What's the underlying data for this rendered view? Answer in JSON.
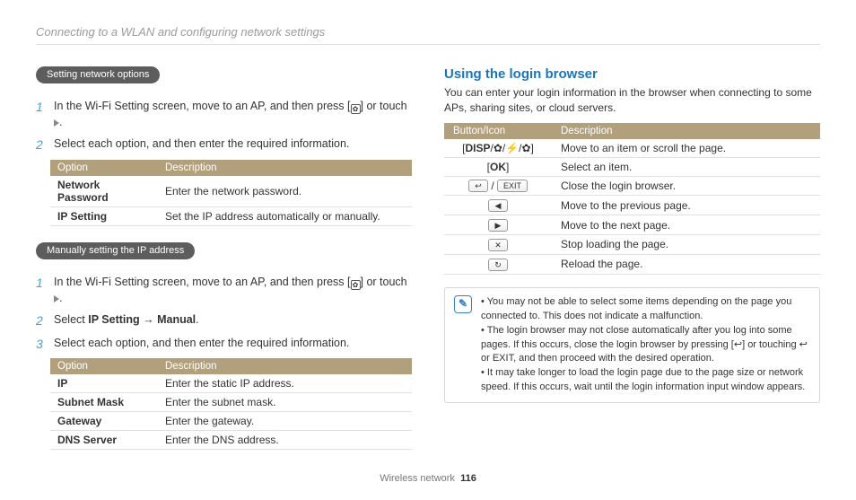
{
  "header": "Connecting to a WLAN and configuring network settings",
  "left": {
    "section1": {
      "pill": "Setting network options",
      "step1_pre": "In the Wi-Fi Setting screen, move to an AP, and then press ",
      "step1_post": " or touch ",
      "step1_end": ".",
      "step2": "Select each option, and then enter the required information.",
      "table": {
        "h1": "Option",
        "h2": "Description",
        "rows": [
          {
            "k": "Network Password",
            "v": "Enter the network password."
          },
          {
            "k": "IP Setting",
            "v": "Set the IP address automatically or manually."
          }
        ]
      }
    },
    "section2": {
      "pill": "Manually setting the IP address",
      "step1_pre": "In the Wi-Fi Setting screen, move to an AP, and then press ",
      "step1_post": " or touch ",
      "step1_end": ".",
      "step2_pre": "Select ",
      "step2_b1": "IP Setting",
      "step2_arrow": " → ",
      "step2_b2": "Manual",
      "step2_end": ".",
      "step3": "Select each option, and then enter the required information.",
      "table": {
        "h1": "Option",
        "h2": "Description",
        "rows": [
          {
            "k": "IP",
            "v": "Enter the static IP address."
          },
          {
            "k": "Subnet Mask",
            "v": "Enter the subnet mask."
          },
          {
            "k": "Gateway",
            "v": "Enter the gateway."
          },
          {
            "k": "DNS Server",
            "v": "Enter the DNS address."
          }
        ]
      }
    }
  },
  "right": {
    "title": "Using the login browser",
    "intro": "You can enter your login information in the browser when connecting to some APs, sharing sites, or cloud servers.",
    "table": {
      "h1": "Button/Icon",
      "h2": "Description",
      "rows": [
        {
          "icon": "disp-nav",
          "v": "Move to an item or scroll the page."
        },
        {
          "icon": "ok",
          "v": "Select an item."
        },
        {
          "icon": "back-exit",
          "v": "Close the login browser."
        },
        {
          "icon": "prev",
          "v": "Move to the previous page."
        },
        {
          "icon": "next",
          "v": "Move to the next page."
        },
        {
          "icon": "stop",
          "v": "Stop loading the page."
        },
        {
          "icon": "reload",
          "v": "Reload the page."
        }
      ]
    },
    "notes": [
      "You may not be able to select some items depending on the page you connected to. This does not indicate a malfunction.",
      "The login browser may not close automatically after you log into some pages. If this occurs, close the login browser by pressing [↩] or touching ↩ or EXIT, and then proceed with the desired operation.",
      "It may take longer to load the login page due to the page size or network speed. If this occurs, wait until the login information input window appears."
    ]
  },
  "footer": {
    "section": "Wireless network",
    "page": "116"
  },
  "icons": {
    "gear": "✿",
    "play": "▶",
    "disp": "DISP",
    "ok": "OK",
    "back": "↩",
    "exit": "EXIT",
    "left": "◀",
    "right": "▶",
    "stop": "✕",
    "reload": "↻"
  }
}
